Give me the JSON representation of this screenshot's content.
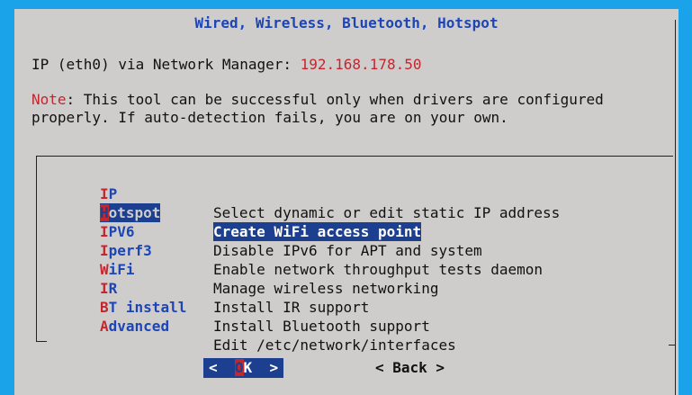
{
  "dialog": {
    "title": "Wired, Wireless, Bluetooth, Hotspot",
    "ip_label": "IP (eth0) via Network Manager: ",
    "ip_value": "192.168.178.50",
    "note_label": "Note",
    "note_line1": ": This tool can be successful only when drivers are configured",
    "note_line2": "properly. If auto-detection fails, you are on your own."
  },
  "menu": {
    "items": [
      {
        "hot": "I",
        "rest": "P",
        "desc": "Select dynamic or edit static IP address"
      },
      {
        "hot": "H",
        "rest": "otspot",
        "desc": "Create WiFi access point"
      },
      {
        "hot": "I",
        "rest": "PV6",
        "desc": "Disable IPv6 for APT and system"
      },
      {
        "hot": "I",
        "rest": "perf3",
        "desc": "Enable network throughput tests daemon"
      },
      {
        "hot": "W",
        "rest": "iFi",
        "desc": "Manage wireless networking"
      },
      {
        "hot": "I",
        "rest": "R",
        "desc": "Install IR support"
      },
      {
        "hot": "B",
        "rest": "T install",
        "desc": "Install Bluetooth support"
      },
      {
        "hot": "A",
        "rest": "dvanced",
        "desc": "Edit /etc/network/interfaces"
      }
    ],
    "selected_index": 1
  },
  "buttons": {
    "ok_left": "<  ",
    "ok_hot": "O",
    "ok_rest": "K  >",
    "back": "< Back >"
  },
  "colors": {
    "background": "#1aa3e8",
    "dialog": "#cfcdcb",
    "accent_blue": "#1d45b5",
    "selection": "#1c3f8f",
    "hotkey_red": "#c4262e"
  }
}
